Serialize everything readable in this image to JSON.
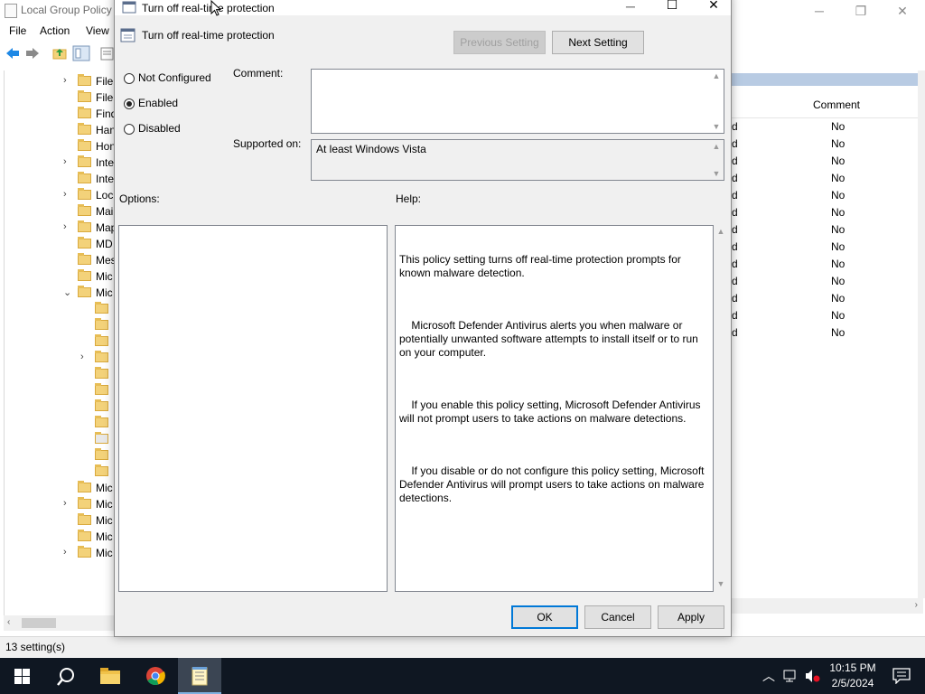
{
  "main_window": {
    "title": "Local Group Policy",
    "controls": {
      "minimize": "─",
      "maximize": "❐",
      "close": "✕"
    },
    "menu": [
      "File",
      "Action",
      "View"
    ],
    "tree_items": [
      {
        "label": "File",
        "expand": "›"
      },
      {
        "label": "File",
        "expand": ""
      },
      {
        "label": "Find",
        "expand": ""
      },
      {
        "label": "Han",
        "expand": ""
      },
      {
        "label": "Hon",
        "expand": ""
      },
      {
        "label": "Inte",
        "expand": "›"
      },
      {
        "label": "Inte",
        "expand": ""
      },
      {
        "label": "Loc",
        "expand": "›"
      },
      {
        "label": "Mai",
        "expand": ""
      },
      {
        "label": "Map",
        "expand": "›"
      },
      {
        "label": "MD",
        "expand": ""
      },
      {
        "label": "Mes",
        "expand": ""
      },
      {
        "label": "Mic",
        "expand": ""
      },
      {
        "label": "Mic",
        "expand": "⌄"
      },
      {
        "label": "",
        "expand": ""
      },
      {
        "label": "",
        "expand": ""
      },
      {
        "label": "",
        "expand": ""
      },
      {
        "label": "",
        "expand": "›"
      },
      {
        "label": "",
        "expand": ""
      },
      {
        "label": "",
        "expand": ""
      },
      {
        "label": "",
        "expand": ""
      },
      {
        "label": "",
        "expand": ""
      },
      {
        "label": "",
        "expand": ""
      },
      {
        "label": "",
        "expand": ""
      },
      {
        "label": "",
        "expand": ""
      },
      {
        "label": "Mic",
        "expand": ""
      },
      {
        "label": "Mic",
        "expand": "›"
      },
      {
        "label": "Mic",
        "expand": ""
      },
      {
        "label": "Mic",
        "expand": ""
      },
      {
        "label": "Mic",
        "expand": "›"
      }
    ],
    "column_header": "Comment",
    "rows": [
      {
        "state": "d",
        "comment": "No"
      },
      {
        "state": "d",
        "comment": "No"
      },
      {
        "state": "d",
        "comment": "No"
      },
      {
        "state": "d",
        "comment": "No"
      },
      {
        "state": "d",
        "comment": "No"
      },
      {
        "state": "d",
        "comment": "No"
      },
      {
        "state": "d",
        "comment": "No"
      },
      {
        "state": "d",
        "comment": "No"
      },
      {
        "state": "d",
        "comment": "No"
      },
      {
        "state": "d",
        "comment": "No"
      },
      {
        "state": "d",
        "comment": "No"
      },
      {
        "state": "d",
        "comment": "No"
      },
      {
        "state": "d",
        "comment": "No"
      }
    ],
    "status": "13 setting(s)"
  },
  "dialog": {
    "title": "Turn off real-time protection",
    "setting_name": "Turn off real-time protection",
    "prev_button": "Previous Setting",
    "next_button": "Next Setting",
    "options": {
      "not_configured": "Not Configured",
      "enabled": "Enabled",
      "disabled": "Disabled",
      "selected": "enabled"
    },
    "comment_label": "Comment:",
    "comment_value": "",
    "supported_label": "Supported on:",
    "supported_value": "At least Windows Vista",
    "options_label": "Options:",
    "help_label": "Help:",
    "help_paragraphs": [
      "This policy setting turns off real-time protection prompts for known malware detection.",
      "    Microsoft Defender Antivirus alerts you when malware or potentially unwanted software attempts to install itself or to run on your computer.",
      "    If you enable this policy setting, Microsoft Defender Antivirus will not prompt users to take actions on malware detections.",
      "    If you disable or do not configure this policy setting, Microsoft Defender Antivirus will prompt users to take actions on malware detections."
    ],
    "ok": "OK",
    "cancel": "Cancel",
    "apply": "Apply"
  },
  "taskbar": {
    "time": "10:15 PM",
    "date": "2/5/2024",
    "apps": [
      "start-icon",
      "search-icon",
      "file-explorer-icon",
      "chrome-icon",
      "notepad-icon"
    ]
  },
  "colors": {
    "accent": "#0078d7",
    "taskbar": "#0f1722",
    "selection_bar": "#b8cbe3"
  }
}
